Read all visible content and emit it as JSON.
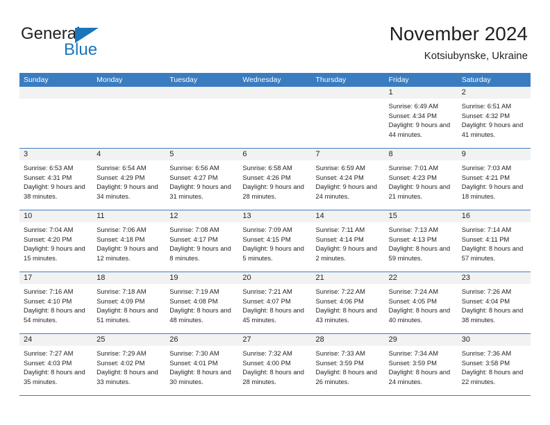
{
  "brand": {
    "name_top": "General",
    "name_bottom": "Blue",
    "accent_color": "#1b75bb"
  },
  "header": {
    "title": "November 2024",
    "location": "Kotsiubynske, Ukraine"
  },
  "theme": {
    "header_row_color": "#3a7cc0",
    "day_bar_color": "#f2f2f2",
    "text_color": "#231f20"
  },
  "weekdays": [
    "Sunday",
    "Monday",
    "Tuesday",
    "Wednesday",
    "Thursday",
    "Friday",
    "Saturday"
  ],
  "weeks": [
    [
      {
        "day": "",
        "empty": true
      },
      {
        "day": "",
        "empty": true
      },
      {
        "day": "",
        "empty": true
      },
      {
        "day": "",
        "empty": true
      },
      {
        "day": "",
        "empty": true
      },
      {
        "day": "1",
        "sunrise": "Sunrise: 6:49 AM",
        "sunset": "Sunset: 4:34 PM",
        "daylight": "Daylight: 9 hours and 44 minutes."
      },
      {
        "day": "2",
        "sunrise": "Sunrise: 6:51 AM",
        "sunset": "Sunset: 4:32 PM",
        "daylight": "Daylight: 9 hours and 41 minutes."
      }
    ],
    [
      {
        "day": "3",
        "sunrise": "Sunrise: 6:53 AM",
        "sunset": "Sunset: 4:31 PM",
        "daylight": "Daylight: 9 hours and 38 minutes."
      },
      {
        "day": "4",
        "sunrise": "Sunrise: 6:54 AM",
        "sunset": "Sunset: 4:29 PM",
        "daylight": "Daylight: 9 hours and 34 minutes."
      },
      {
        "day": "5",
        "sunrise": "Sunrise: 6:56 AM",
        "sunset": "Sunset: 4:27 PM",
        "daylight": "Daylight: 9 hours and 31 minutes."
      },
      {
        "day": "6",
        "sunrise": "Sunrise: 6:58 AM",
        "sunset": "Sunset: 4:26 PM",
        "daylight": "Daylight: 9 hours and 28 minutes."
      },
      {
        "day": "7",
        "sunrise": "Sunrise: 6:59 AM",
        "sunset": "Sunset: 4:24 PM",
        "daylight": "Daylight: 9 hours and 24 minutes."
      },
      {
        "day": "8",
        "sunrise": "Sunrise: 7:01 AM",
        "sunset": "Sunset: 4:23 PM",
        "daylight": "Daylight: 9 hours and 21 minutes."
      },
      {
        "day": "9",
        "sunrise": "Sunrise: 7:03 AM",
        "sunset": "Sunset: 4:21 PM",
        "daylight": "Daylight: 9 hours and 18 minutes."
      }
    ],
    [
      {
        "day": "10",
        "sunrise": "Sunrise: 7:04 AM",
        "sunset": "Sunset: 4:20 PM",
        "daylight": "Daylight: 9 hours and 15 minutes."
      },
      {
        "day": "11",
        "sunrise": "Sunrise: 7:06 AM",
        "sunset": "Sunset: 4:18 PM",
        "daylight": "Daylight: 9 hours and 12 minutes."
      },
      {
        "day": "12",
        "sunrise": "Sunrise: 7:08 AM",
        "sunset": "Sunset: 4:17 PM",
        "daylight": "Daylight: 9 hours and 8 minutes."
      },
      {
        "day": "13",
        "sunrise": "Sunrise: 7:09 AM",
        "sunset": "Sunset: 4:15 PM",
        "daylight": "Daylight: 9 hours and 5 minutes."
      },
      {
        "day": "14",
        "sunrise": "Sunrise: 7:11 AM",
        "sunset": "Sunset: 4:14 PM",
        "daylight": "Daylight: 9 hours and 2 minutes."
      },
      {
        "day": "15",
        "sunrise": "Sunrise: 7:13 AM",
        "sunset": "Sunset: 4:13 PM",
        "daylight": "Daylight: 8 hours and 59 minutes."
      },
      {
        "day": "16",
        "sunrise": "Sunrise: 7:14 AM",
        "sunset": "Sunset: 4:11 PM",
        "daylight": "Daylight: 8 hours and 57 minutes."
      }
    ],
    [
      {
        "day": "17",
        "sunrise": "Sunrise: 7:16 AM",
        "sunset": "Sunset: 4:10 PM",
        "daylight": "Daylight: 8 hours and 54 minutes."
      },
      {
        "day": "18",
        "sunrise": "Sunrise: 7:18 AM",
        "sunset": "Sunset: 4:09 PM",
        "daylight": "Daylight: 8 hours and 51 minutes."
      },
      {
        "day": "19",
        "sunrise": "Sunrise: 7:19 AM",
        "sunset": "Sunset: 4:08 PM",
        "daylight": "Daylight: 8 hours and 48 minutes."
      },
      {
        "day": "20",
        "sunrise": "Sunrise: 7:21 AM",
        "sunset": "Sunset: 4:07 PM",
        "daylight": "Daylight: 8 hours and 45 minutes."
      },
      {
        "day": "21",
        "sunrise": "Sunrise: 7:22 AM",
        "sunset": "Sunset: 4:06 PM",
        "daylight": "Daylight: 8 hours and 43 minutes."
      },
      {
        "day": "22",
        "sunrise": "Sunrise: 7:24 AM",
        "sunset": "Sunset: 4:05 PM",
        "daylight": "Daylight: 8 hours and 40 minutes."
      },
      {
        "day": "23",
        "sunrise": "Sunrise: 7:26 AM",
        "sunset": "Sunset: 4:04 PM",
        "daylight": "Daylight: 8 hours and 38 minutes."
      }
    ],
    [
      {
        "day": "24",
        "sunrise": "Sunrise: 7:27 AM",
        "sunset": "Sunset: 4:03 PM",
        "daylight": "Daylight: 8 hours and 35 minutes."
      },
      {
        "day": "25",
        "sunrise": "Sunrise: 7:29 AM",
        "sunset": "Sunset: 4:02 PM",
        "daylight": "Daylight: 8 hours and 33 minutes."
      },
      {
        "day": "26",
        "sunrise": "Sunrise: 7:30 AM",
        "sunset": "Sunset: 4:01 PM",
        "daylight": "Daylight: 8 hours and 30 minutes."
      },
      {
        "day": "27",
        "sunrise": "Sunrise: 7:32 AM",
        "sunset": "Sunset: 4:00 PM",
        "daylight": "Daylight: 8 hours and 28 minutes."
      },
      {
        "day": "28",
        "sunrise": "Sunrise: 7:33 AM",
        "sunset": "Sunset: 3:59 PM",
        "daylight": "Daylight: 8 hours and 26 minutes."
      },
      {
        "day": "29",
        "sunrise": "Sunrise: 7:34 AM",
        "sunset": "Sunset: 3:59 PM",
        "daylight": "Daylight: 8 hours and 24 minutes."
      },
      {
        "day": "30",
        "sunrise": "Sunrise: 7:36 AM",
        "sunset": "Sunset: 3:58 PM",
        "daylight": "Daylight: 8 hours and 22 minutes."
      }
    ]
  ]
}
